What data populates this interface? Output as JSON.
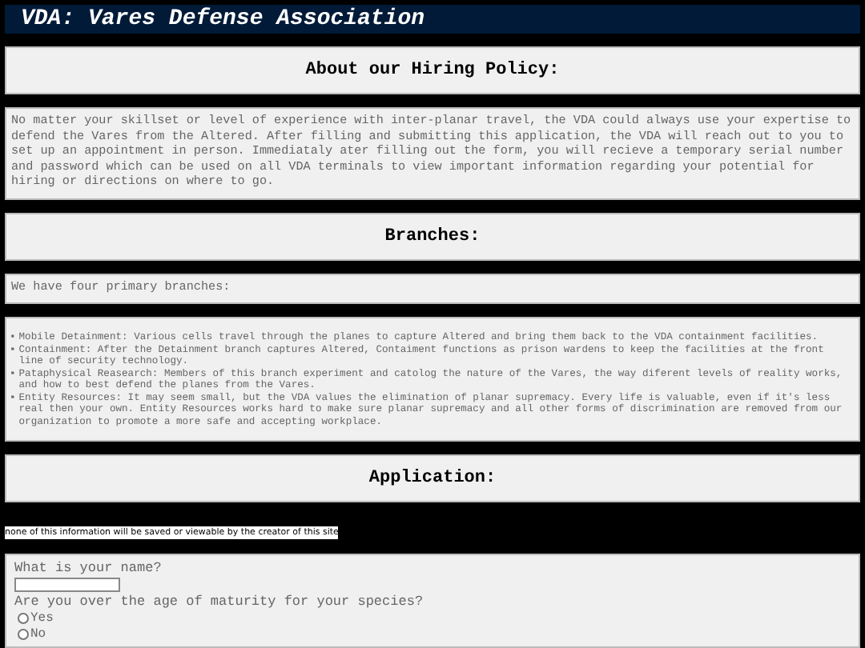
{
  "header": {
    "title": "VDA: Vares Defense Association"
  },
  "sections": [
    {
      "heading": "About our Hiring Policy:",
      "paragraphs": [
        "No matter your skillset or level of experience with inter-planar travel, the VDA could always use your expertise to defend the Vares from the Altered. After filling and submitting this application, the VDA will reach out to you to set up an appointment in person. Immediataly ater filling out the form, you will recieve a temporary serial number and password which can be used on all VDA terminals to view important information regarding your potential for hiring or directions on where to go."
      ]
    },
    {
      "heading": "Branches:",
      "paragraphs": [
        "We have four primary branches:"
      ],
      "list": [
        {
          "marker": "▪",
          "text": "Mobile Detainment: Various cells travel through the planes to capture Altered and bring them back to the VDA containment facilities."
        },
        {
          "marker": "▪",
          "text": "Containment: After the Detainment branch captures Altered, Contaiment functions as prison wardens to keep the facilities at the front line of security technology."
        },
        {
          "marker": "▪",
          "text": "Pataphysical Reasearch: Members of this branch experiment and catolog the nature of the Vares, the way diferent levels of reality works, and how to best defend the planes from the Vares."
        },
        {
          "marker": "▪",
          "text": "Entity Resources: It may seem small, but the VDA values the elimination of planar supremacy. Every life is valuable, even if it's less real then your own. Entity Resources works hard to make sure planar supremacy and all other forms of discrimination are removed from our organization to promote a more safe and accepting workplace."
        }
      ]
    },
    {
      "heading": "Application:",
      "note": "none of this information will be saved or viewable by the creator of this site",
      "form": [
        {
          "kind": "text",
          "question": "What is your name?"
        },
        {
          "kind": "radio",
          "question": "Are you over the age of maturity for your species?",
          "options": [
            {
              "label": "Yes",
              "selected": false
            },
            {
              "label": "No",
              "selected": false
            }
          ]
        }
      ]
    }
  ]
}
